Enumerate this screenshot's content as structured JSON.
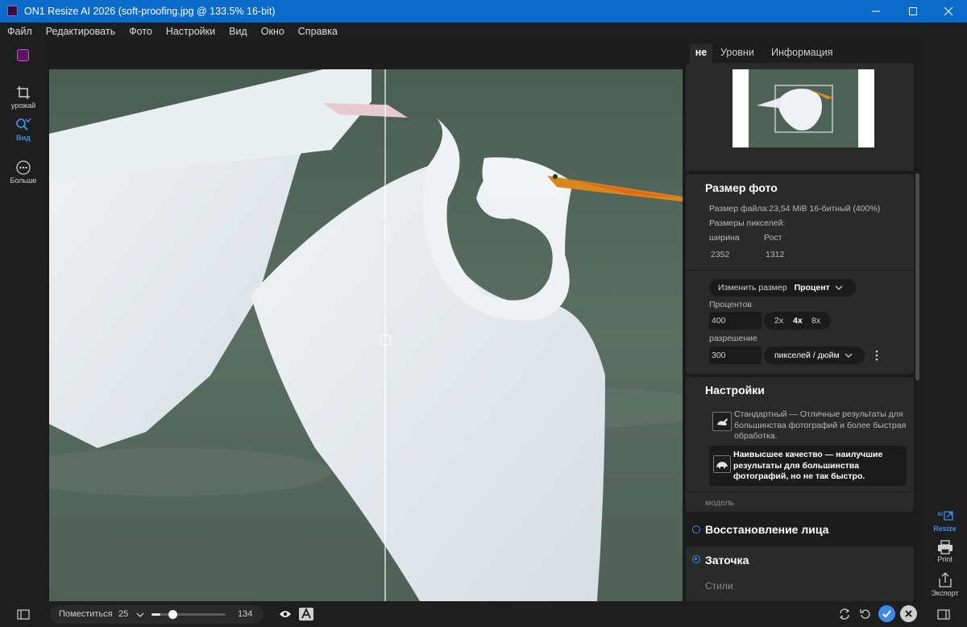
{
  "window": {
    "title": "ON1 Resize AI 2026 (soft-proofing.jpg @ 133.5% 16-bit)"
  },
  "menu": [
    "Файл",
    "Редактировать",
    "Фото",
    "Настройки",
    "Вид",
    "Окно",
    "Справка"
  ],
  "left_tools": {
    "crop": "урожай",
    "view": "Вид",
    "more": "Больше"
  },
  "panel_tabs": [
    "не",
    "Уровни",
    "Информация"
  ],
  "photo_size": {
    "title": "Размер фото",
    "file_size": "Размер файла:23,54 MiB 16-битный (400%)",
    "pixel_dims_label": "Размеры пикселей:",
    "width_label": "ширина",
    "height_label": "Рост",
    "width_value": "2352",
    "height_value": "1312",
    "resize_by_label": "Изменить размер",
    "resize_by_value": "Процент",
    "percent_label": "Процентов",
    "percent_value": "400",
    "scale_options": [
      "2x",
      "4x",
      "8x"
    ],
    "selected_scale": "4x",
    "resolution_label": "разрешение",
    "resolution_value": "300",
    "resolution_unit": "пикселей / дюйм"
  },
  "settings": {
    "title": "Настройки",
    "standard_text": "Стандартный — Отличные результаты для большинства фотографий и более быстрая обработка.",
    "highest_text": "Наивысшее качество — наилучшие результаты для большинства фотографий, но не так быстро.",
    "model_label": "модель"
  },
  "face_recovery": {
    "label": "Восстановление лица"
  },
  "sharpening": {
    "label": "Заточка",
    "styles_label": "Стили"
  },
  "right_rail": {
    "resize": "Resize",
    "print": "Print",
    "export": "Экспорт",
    "ai_badge": "AI"
  },
  "bottom_bar": {
    "fit_label": "Поместиться",
    "zoom_value": "25",
    "slider_value": "134",
    "slider_fraction": 0.12
  },
  "colors": {
    "accent": "#3d8be6",
    "titlebar": "#0b6bc8",
    "panel": "#2a2a2a"
  }
}
